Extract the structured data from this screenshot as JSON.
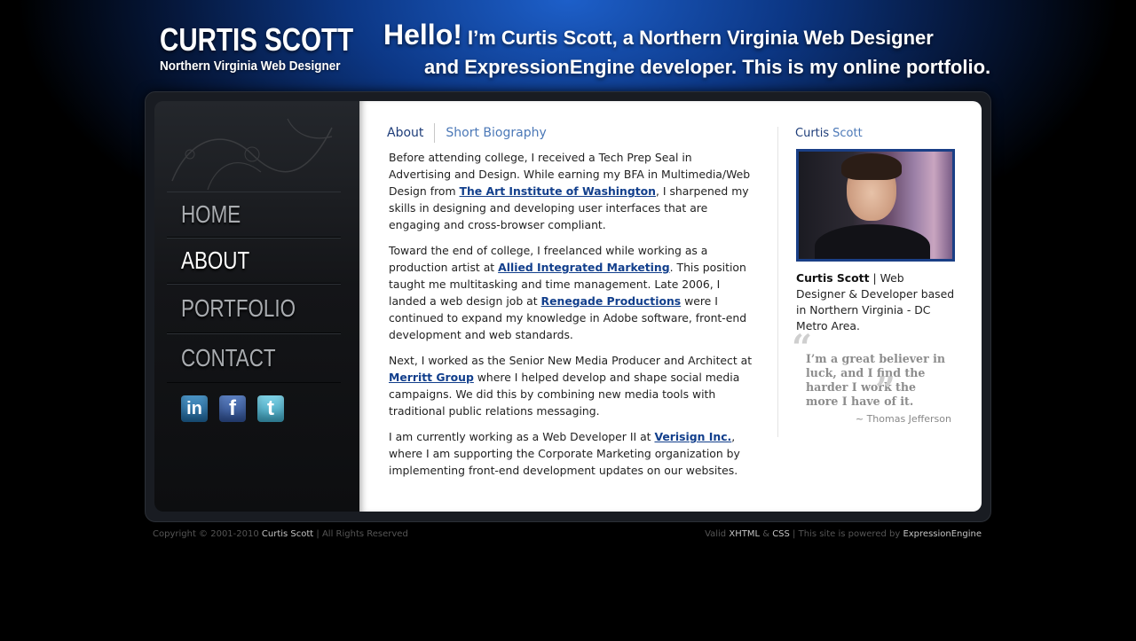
{
  "header": {
    "name": "CURTIS SCOTT",
    "tagline": "Northern Virginia Web Designer",
    "hello_big": "Hello!",
    "hello_line1": " I’m Curtis Scott, a Northern Virginia Web Designer",
    "hello_line2": "and ExpressionEngine developer. This is my online portfolio."
  },
  "nav": {
    "items": [
      {
        "label": "HOME"
      },
      {
        "label": "ABOUT"
      },
      {
        "label": "PORTFOLIO"
      },
      {
        "label": "CONTACT"
      }
    ],
    "active": "ABOUT"
  },
  "social": {
    "linkedin": "in",
    "facebook": "f",
    "twitter": "t"
  },
  "breadcrumb": {
    "section": "About",
    "page": "Short Biography"
  },
  "content": {
    "p1_a": "Before attending college, I received a Tech Prep Seal in Advertising and Design. While earning my BFA in Multimedia/Web Design from ",
    "p1_link": "The Art Institute of Washington",
    "p1_b": ", I sharpened my skills in designing and developing user interfaces that are engaging and cross-browser compliant.",
    "p2_a": "Toward the end of college, I freelanced while working as a production artist at ",
    "p2_link1": "Allied Integrated Marketing",
    "p2_b": ". This position taught me multitasking and time management. Late 2006, I landed a web design job at ",
    "p2_link2": "Renegade Productions",
    "p2_c": " were I continued to expand my knowledge in Adobe software, front-end development and web standards.",
    "p3_a": "Next, I worked as the Senior New Media Producer and Architect at ",
    "p3_link": "Merritt Group",
    "p3_b": " where I helped develop and shape social media campaigns. We did this by combining new media tools with traditional public relations messaging.",
    "p4_a": "I am currently working as a Web Developer II at ",
    "p4_link": "Verisign Inc.",
    "p4_b": ", where I am supporting the Corporate Marketing organization by implementing front-end development updates on our websites."
  },
  "aside": {
    "first": "Curtis",
    "last": "Scott",
    "bio_name": "Curtis Scott",
    "bio_rest": " | Web Designer & Developer based in Northern Virginia - DC Metro Area.",
    "quote_open": "“",
    "quote_close": "”",
    "quote": "I’m a great believer in luck, and I find the harder I work the more I have of it.",
    "quote_author": "~ Thomas Jefferson"
  },
  "footer": {
    "copyright": "Copyright © 2001-2010 ",
    "owner": "Curtis Scott",
    "rights": " | All Rights Reserved",
    "valid": "Valid ",
    "xhtml": "XHTML",
    "amp": " & ",
    "css": "CSS",
    "powered": " | This site is powered by ",
    "ee": "ExpressionEngine"
  }
}
